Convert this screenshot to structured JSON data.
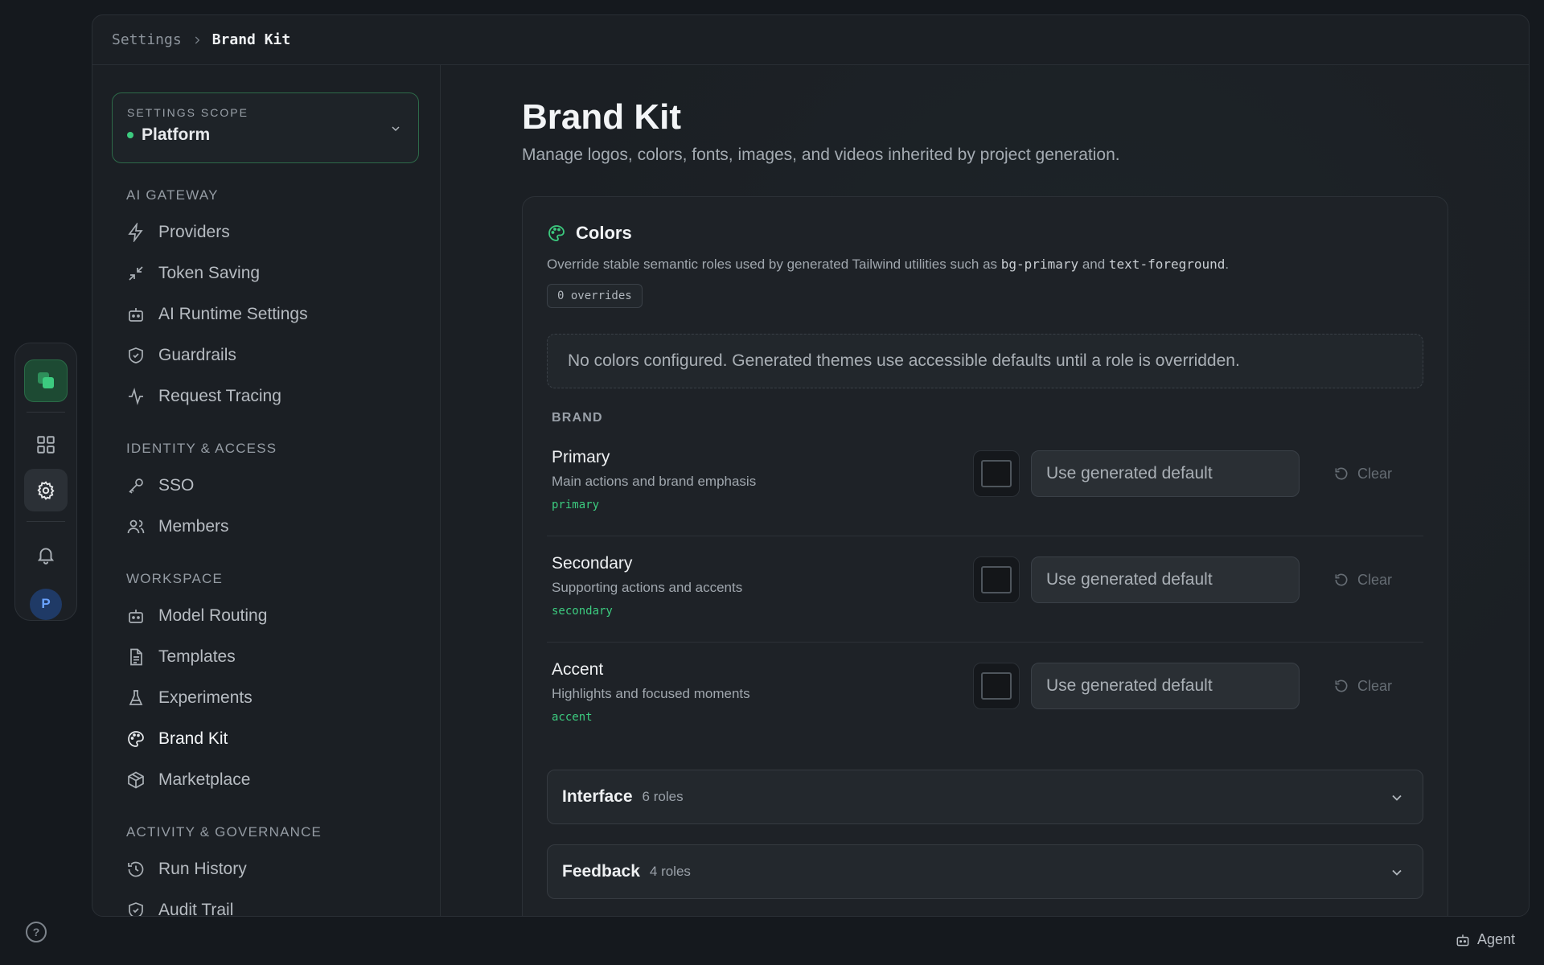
{
  "breadcrumb": {
    "parent": "Settings",
    "current": "Brand Kit"
  },
  "rail": {
    "avatar_initial": "P"
  },
  "sidebar": {
    "scope": {
      "label": "SETTINGS SCOPE",
      "value": "Platform"
    },
    "sections": [
      {
        "label": "AI GATEWAY",
        "items": [
          "Providers",
          "Token Saving",
          "AI Runtime Settings",
          "Guardrails",
          "Request Tracing"
        ]
      },
      {
        "label": "IDENTITY & ACCESS",
        "items": [
          "SSO",
          "Members"
        ]
      },
      {
        "label": "WORKSPACE",
        "items": [
          "Model Routing",
          "Templates",
          "Experiments",
          "Brand Kit",
          "Marketplace"
        ]
      },
      {
        "label": "ACTIVITY & GOVERNANCE",
        "items": [
          "Run History",
          "Audit Trail"
        ]
      }
    ],
    "active_item": "Brand Kit"
  },
  "page": {
    "title": "Brand Kit",
    "subtitle": "Manage logos, colors, fonts, images, and videos inherited by project generation."
  },
  "colors_card": {
    "title": "Colors",
    "desc_prefix": "Override stable semantic roles used by generated Tailwind utilities such as ",
    "desc_code1": "bg-primary",
    "desc_mid": " and ",
    "desc_code2": "text-foreground",
    "desc_suffix": ".",
    "badge": "0 overrides",
    "empty_message": "No colors configured. Generated themes use accessible defaults until a role is overridden.",
    "group_label": "BRAND",
    "roles": [
      {
        "name": "Primary",
        "desc": "Main actions and brand emphasis",
        "token": "primary",
        "placeholder": "Use generated default",
        "clear": "Clear"
      },
      {
        "name": "Secondary",
        "desc": "Supporting actions and accents",
        "token": "secondary",
        "placeholder": "Use generated default",
        "clear": "Clear"
      },
      {
        "name": "Accent",
        "desc": "Highlights and focused moments",
        "token": "accent",
        "placeholder": "Use generated default",
        "clear": "Clear"
      }
    ],
    "accordions": [
      {
        "title": "Interface",
        "count": "6 roles"
      },
      {
        "title": "Feedback",
        "count": "4 roles"
      }
    ]
  },
  "footer": {
    "agent_label": "Agent",
    "help_glyph": "?"
  },
  "colors": {
    "accent_green": "#3ccb7f",
    "background": "#15191e",
    "panel": "#1b1f24"
  }
}
